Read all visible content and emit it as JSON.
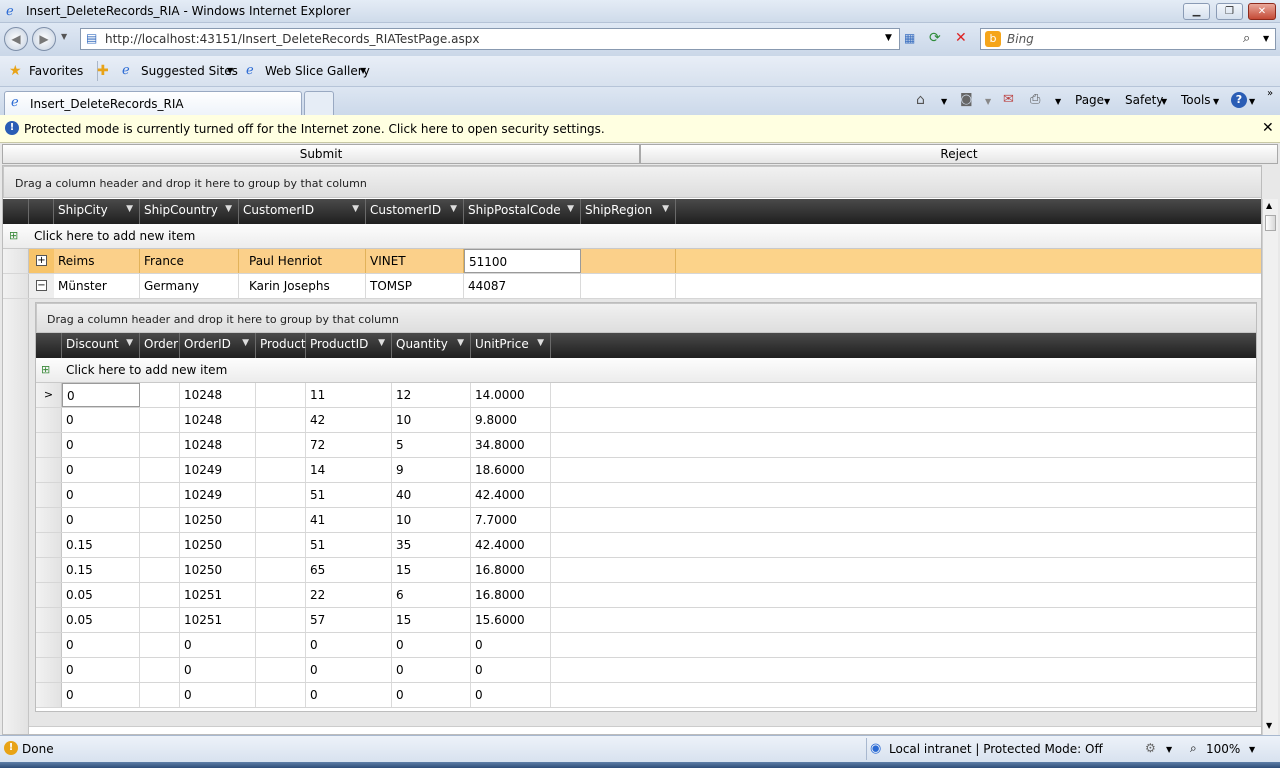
{
  "window": {
    "title": "Insert_DeleteRecords_RIA - Windows Internet Explorer"
  },
  "address": {
    "url": "http://localhost:43151/Insert_DeleteRecords_RIATestPage.aspx",
    "search_placeholder": "Bing"
  },
  "favorites": {
    "label": "Favorites",
    "items": [
      "Suggested Sites",
      "Web Slice Gallery"
    ]
  },
  "tab": {
    "label": "Insert_DeleteRecords_RIA"
  },
  "toolbar": {
    "page": "Page",
    "safety": "Safety",
    "tools": "Tools"
  },
  "infobar": {
    "text": "Protected mode is currently turned off for the Internet zone.  Click here to open security settings."
  },
  "app": {
    "submit_label": "Submit",
    "reject_label": "Reject",
    "group_hint": "Drag a column header and drop it here to group by that column",
    "add_item": "Click here to add new item",
    "outer_columns": [
      "ShipCity",
      "ShipCountry",
      "CustomerID",
      "CustomerID",
      "ShipPostalCode",
      "ShipRegion"
    ],
    "outer_rows": [
      {
        "expander": "+",
        "cells": [
          "Reims",
          "France",
          "Paul Henriot",
          "VINET",
          "51100",
          ""
        ]
      },
      {
        "expander": "−",
        "cells": [
          "Münster",
          "Germany",
          "Karin Josephs",
          "TOMSP",
          "44087",
          ""
        ]
      }
    ],
    "inner_columns": [
      "Discount",
      "Order",
      "OrderID",
      "Product",
      "ProductID",
      "Quantity",
      "UnitPrice"
    ],
    "inner_rows": [
      [
        "0",
        "",
        "10248",
        "",
        "11",
        "12",
        "14.0000"
      ],
      [
        "0",
        "",
        "10248",
        "",
        "42",
        "10",
        "9.8000"
      ],
      [
        "0",
        "",
        "10248",
        "",
        "72",
        "5",
        "34.8000"
      ],
      [
        "0",
        "",
        "10249",
        "",
        "14",
        "9",
        "18.6000"
      ],
      [
        "0",
        "",
        "10249",
        "",
        "51",
        "40",
        "42.4000"
      ],
      [
        "0",
        "",
        "10250",
        "",
        "41",
        "10",
        "7.7000"
      ],
      [
        "0.15",
        "",
        "10250",
        "",
        "51",
        "35",
        "42.4000"
      ],
      [
        "0.15",
        "",
        "10250",
        "",
        "65",
        "15",
        "16.8000"
      ],
      [
        "0.05",
        "",
        "10251",
        "",
        "22",
        "6",
        "16.8000"
      ],
      [
        "0.05",
        "",
        "10251",
        "",
        "57",
        "15",
        "15.6000"
      ],
      [
        "0",
        "",
        "0",
        "",
        "0",
        "0",
        "0"
      ],
      [
        "0",
        "",
        "0",
        "",
        "0",
        "0",
        "0"
      ],
      [
        "0",
        "",
        "0",
        "",
        "0",
        "0",
        "0"
      ]
    ],
    "current_row_marker": ">"
  },
  "status": {
    "text": "Done",
    "zone": "Local intranet | Protected Mode: Off",
    "zoom": "100%"
  }
}
